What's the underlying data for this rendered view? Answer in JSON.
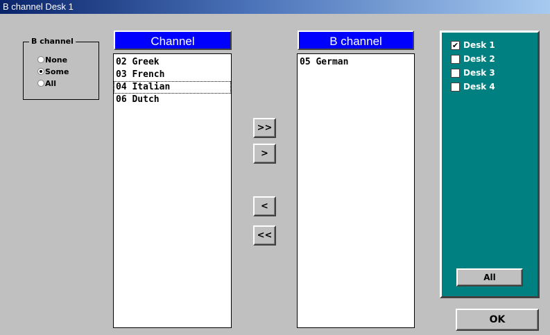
{
  "window": {
    "title": "B channel Desk  1"
  },
  "bchannel_group": {
    "label": "B channel",
    "options": [
      {
        "label": "None",
        "selected": false
      },
      {
        "label": "Some",
        "selected": true
      },
      {
        "label": "All",
        "selected": false
      }
    ]
  },
  "channel_list": {
    "header": "Channel",
    "items": [
      "02  Greek",
      "03  French",
      "04  Italian",
      "06  Dutch"
    ],
    "focused_index": 2
  },
  "bchannel_list": {
    "header": "B channel",
    "items": [
      "05  German"
    ]
  },
  "transfer_buttons": {
    "add_all": ">>",
    "add": ">",
    "remove": "<",
    "remove_all": "<<"
  },
  "desks": {
    "items": [
      {
        "label": "Desk  1",
        "checked": true
      },
      {
        "label": "Desk  2",
        "checked": false
      },
      {
        "label": "Desk  3",
        "checked": false
      },
      {
        "label": "Desk  4",
        "checked": false
      }
    ],
    "all_button": "All",
    "panel_color": "#008080"
  },
  "ok_button": "OK",
  "colors": {
    "header_blue": "#0000ff",
    "dialog_gray": "#c0c0c0"
  }
}
